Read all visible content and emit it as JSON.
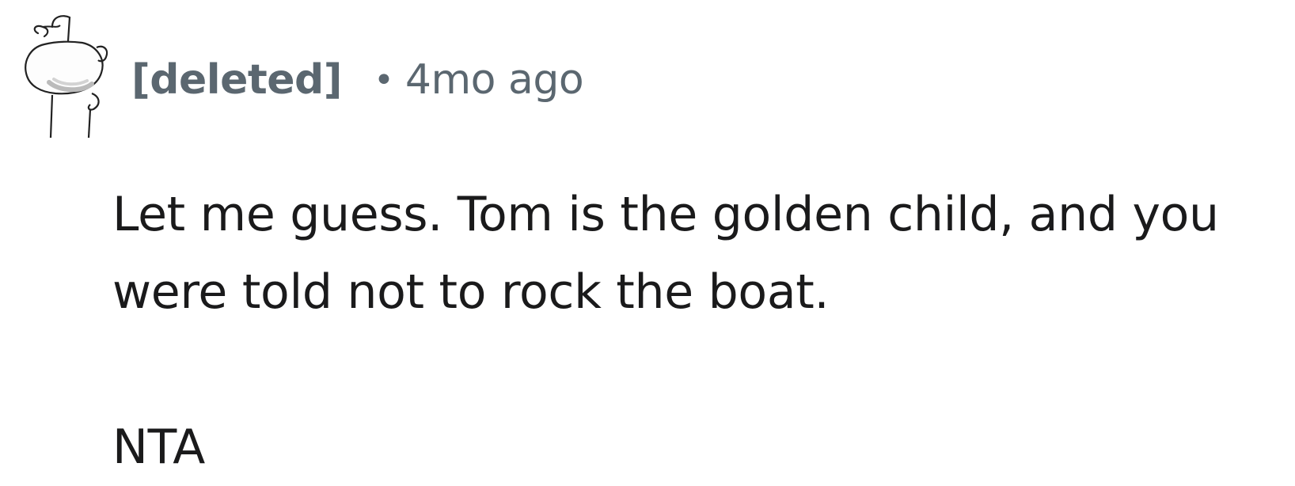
{
  "comment": {
    "author": "[deleted]",
    "separator": "•",
    "timestamp": "4mo ago",
    "avatar_icon": "snoo-avatar-icon",
    "body": "Let me guess. Tom is the golden child, and you were told not to rock the boat.",
    "verdict": "NTA"
  },
  "colors": {
    "meta_text": "#5b6770",
    "body_text": "#1a1a1b",
    "background": "#ffffff"
  }
}
